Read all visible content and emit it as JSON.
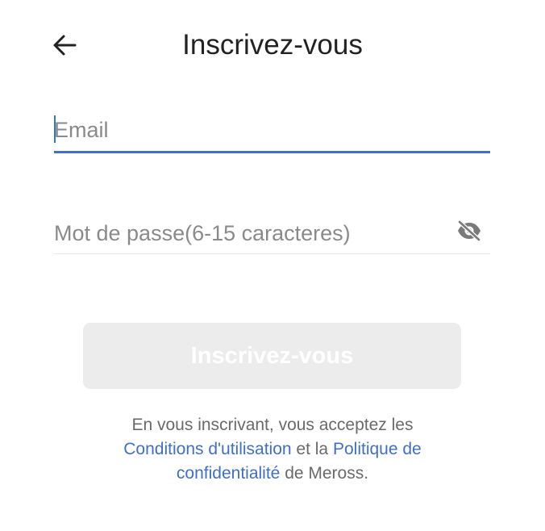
{
  "header": {
    "title": "Inscrivez-vous",
    "back_icon": "back-arrow-icon"
  },
  "form": {
    "email": {
      "value": "",
      "placeholder": "Email"
    },
    "password": {
      "value": "",
      "placeholder": "Mot de passe(6-15 caracteres)",
      "visibility_icon": "eye-off-icon"
    },
    "submit_label": "Inscrivez-vous"
  },
  "terms": {
    "prefix": "En vous inscrivant, vous acceptez les",
    "conditions_link": "Conditions d'utilisation",
    "and_text": "et la",
    "privacy_link_line1": "Politique de",
    "privacy_link_line2": "confidentialité",
    "suffix": "de Meross."
  },
  "colors": {
    "accent": "#3f6fd1",
    "link": "#3f6fc8",
    "button_disabled_bg": "#ececec",
    "placeholder": "#8a8a8a"
  }
}
